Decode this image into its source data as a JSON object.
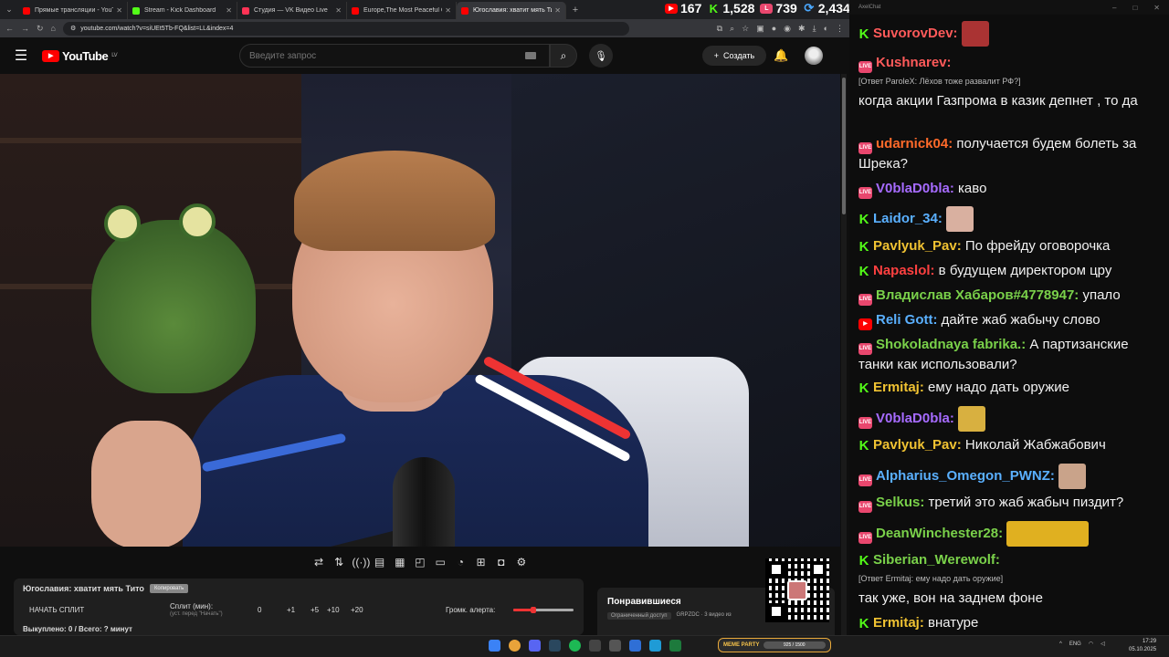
{
  "browser": {
    "tabs": [
      {
        "title": "Прямые трансляции - YouTube",
        "color": "#ff0000",
        "active": false
      },
      {
        "title": "Stream - Kick Dashboard",
        "color": "#53fc18",
        "active": false
      },
      {
        "title": "Студия — VK Видео Live",
        "color": "#ff3355",
        "active": false
      },
      {
        "title": "Europe,The Most Peaceful Con",
        "color": "#ff0000",
        "active": false
      },
      {
        "title": "Югославия: хватит мять Ти",
        "color": "#ff0000",
        "active": true
      }
    ],
    "url": "youtube.com/watch?v=siUEt5Tb-FQ&list=LL&index=4"
  },
  "counters": [
    {
      "platform": "youtube",
      "value": "167",
      "color": "#ff0000"
    },
    {
      "platform": "kick",
      "value": "1,528",
      "color": "#53fc18"
    },
    {
      "platform": "vk",
      "value": "739",
      "color": "#e9476e"
    },
    {
      "platform": "total",
      "value": "2,434",
      "color": "#4aa8ff"
    }
  ],
  "youtube": {
    "logo": "YouTube",
    "region": "LV",
    "search_placeholder": "Введите запрос",
    "create_label": "Создать"
  },
  "split": {
    "title": "Югославия: хватит мять Тито",
    "copy_label": "Копировать",
    "start_label": "НАЧАТЬ СПЛИТ",
    "split_label": "Сплит (мин):",
    "split_hint": "(уст. перед \"Начать\")",
    "value": "0",
    "plus1": "+1",
    "plus5": "+5",
    "plus10": "+10",
    "plus20": "+20",
    "volume_label": "Громк. алерта:",
    "volume_level": 0.33,
    "footer": "Выкуплено: 0 / Всего: ? минут"
  },
  "liked": {
    "title": "Понравившиеся",
    "access": "Ограниченный доступ",
    "owner": "GRPZDC · 3 видео из"
  },
  "chat": {
    "window_title": "AxelChat",
    "messages": [
      {
        "platform": "kick",
        "nick": "SuvorovDev:",
        "color": "#ff5a5a",
        "text": "",
        "emote": "#a33"
      },
      {
        "platform": "live",
        "nick": "Kushnarev:",
        "color": "#ff5a5a",
        "text": "",
        "reply": "[Ответ ParoleX: Лёхов тоже развалит РФ?]"
      },
      {
        "platform": "none",
        "nick": "",
        "color": "#fff",
        "text": "когда акции Газпрома в казик депнет , то да"
      },
      {
        "platform": "live",
        "nick": "udarnick04:",
        "color": "#ff6a2a",
        "text": " получается будем болеть за Шрека?"
      },
      {
        "platform": "live",
        "nick": "V0blaD0bla:",
        "color": "#a66bff",
        "text": " каво"
      },
      {
        "platform": "kick",
        "nick": "Laidor_34:",
        "color": "#5ab0ff",
        "text": "",
        "emote": "#d9b0a0"
      },
      {
        "platform": "kick",
        "nick": "Pavlyuk_Pav:",
        "color": "#f0c232",
        "text": " По фрейду оговорочка"
      },
      {
        "platform": "kick",
        "nick": "Napaslol:",
        "color": "#ff4040",
        "text": " в будущем директором цру"
      },
      {
        "platform": "live",
        "nick": "Владислав Хабаров#4778947:",
        "color": "#7ad14a",
        "text": " упало"
      },
      {
        "platform": "yt",
        "nick": "Reli Gott:",
        "color": "#5ab0ff",
        "text": " дайте жаб жабычу слово"
      },
      {
        "platform": "live",
        "nick": "Shokoladnaya fabrika.:",
        "color": "#7ad14a",
        "text": " А партизанские танки как использовали?"
      },
      {
        "platform": "kick",
        "nick": "Ermitaj:",
        "color": "#f0c232",
        "text": " ему надо дать оружие"
      },
      {
        "platform": "live",
        "nick": "V0blaD0bla:",
        "color": "#a66bff",
        "text": "",
        "emote": "#d8b040"
      },
      {
        "platform": "kick",
        "nick": "Pavlyuk_Pav:",
        "color": "#f0c232",
        "text": " Николай Жабжабович"
      },
      {
        "platform": "live",
        "nick": "Alpharius_Omegon_PWNZ:",
        "color": "#5ab0ff",
        "text": "",
        "emote": "#c9a38a"
      },
      {
        "platform": "live",
        "nick": "Selkus:",
        "color": "#7ad14a",
        "text": " третий это жаб жабыч пиздит?"
      },
      {
        "platform": "live",
        "nick": "DeanWinchester28:",
        "color": "#7ad14a",
        "text": "",
        "emote": "#e0b020"
      },
      {
        "platform": "kick",
        "nick": "Siberian_Werewolf:",
        "color": "#7ad14a",
        "text": "",
        "reply": "[Ответ Ermitaj: ему надо дать оружие]"
      },
      {
        "platform": "none",
        "nick": "",
        "color": "#fff",
        "text": "так уже, вон на заднем фоне"
      },
      {
        "platform": "kick",
        "nick": "Ermitaj:",
        "color": "#f0c232",
        "text": " внатуре"
      }
    ]
  },
  "taskbar": {
    "meme_label": "MEME PARTY",
    "meme_progress": "925 / 1500",
    "lang": "ENG",
    "time": "17:29",
    "date": "05.10.2025"
  }
}
